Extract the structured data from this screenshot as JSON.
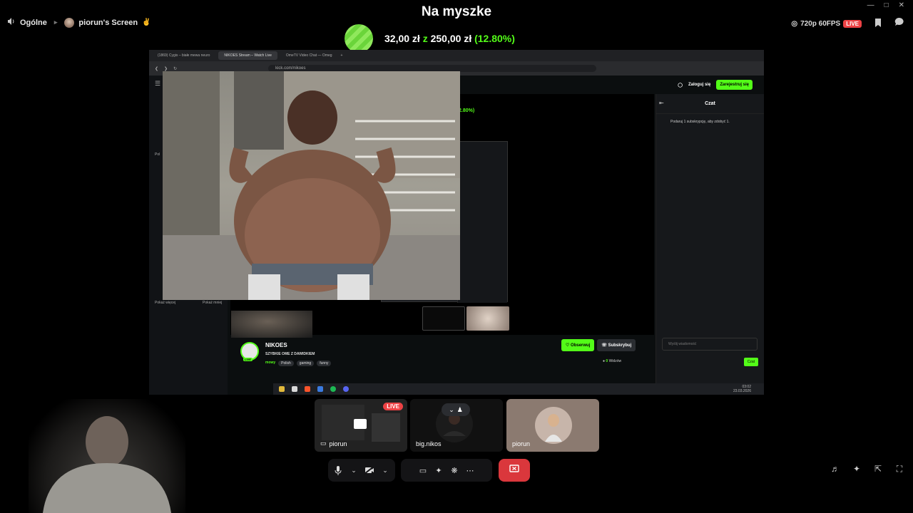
{
  "header": {
    "channel": "Ogólne",
    "screen_owner": "piorun's Screen",
    "title": "Na myszke",
    "quality": "720p 60FPS",
    "live": "LIVE"
  },
  "donation": {
    "current": "32,00 zł",
    "separator": "z",
    "goal": "250,00 zł",
    "percent": "(12.80%)",
    "progress": 0.128
  },
  "browser": {
    "tabs": [
      "(1869) Cygis – białe mewa neuro",
      "NIKOES Stream – Watch Live",
      "OmeTV Video Chat — Omeg"
    ],
    "new_tab": "+",
    "url": "kick.com/nikoes"
  },
  "kick": {
    "login": "Zaloguj się",
    "register": "Zarejestruj się",
    "side_heading": "Pol",
    "show_more": "Pokaż więcej",
    "show_less": "Pokaż mniej",
    "percent_fragment": "2.80%)",
    "chat_title": "Czat",
    "chat_gift": "Podaruj 1 subskrypcję, aby zdobyć 1.",
    "chat_placeholder": "Wyślij wiadomość",
    "chat_send": "Czat",
    "streamer": "NIKOES",
    "stream_title": "SZYBKIE OME Z DAWIDKIEM",
    "live_tag": "LIVE",
    "category": "mowy",
    "tags": [
      "Polish",
      "gaming",
      "funny"
    ],
    "follow": "Obserwuj",
    "subscribe": "Subskrybuj",
    "viewers_count": "0",
    "viewers_label": "Widzów",
    "clock_time": "03:02",
    "clock_date": "23.03.2026"
  },
  "participants": [
    {
      "name": "piorun",
      "live": "LIVE"
    },
    {
      "name": "big.nikos"
    },
    {
      "name": "piorun"
    }
  ],
  "colors": {
    "kick_green": "#53fc18",
    "live_red": "#ed4245",
    "hangup_red": "#da373c"
  }
}
